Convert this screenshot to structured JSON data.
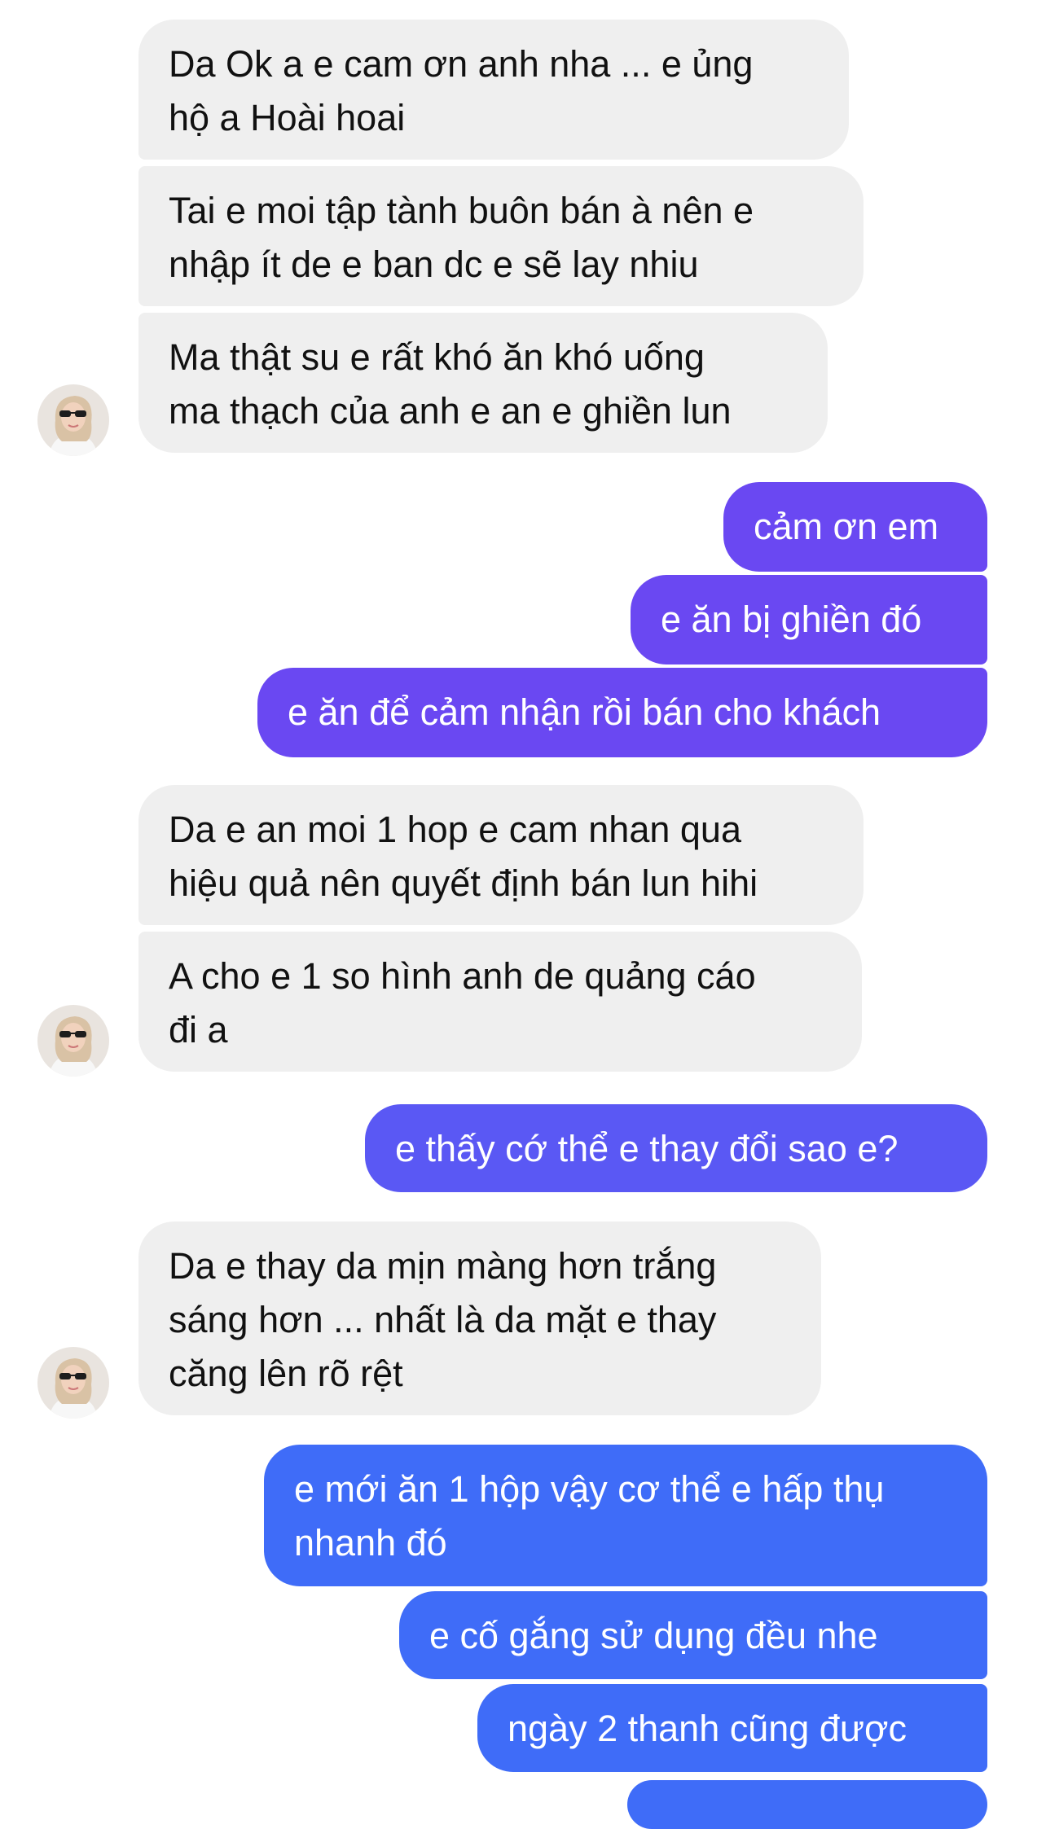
{
  "colors": {
    "incoming_bg": "#efefef",
    "outgoing_purple": "#6a48f2",
    "outgoing_blue": "#3f6cf8",
    "incoming_text": "#111111",
    "outgoing_text": "#ffffff"
  },
  "contact": {
    "avatar_icon": "profile-photo-woman-sunglasses"
  },
  "messages": [
    {
      "side": "incoming",
      "lines": [
        "Da Ok a e cam ơn anh nha ... e ủng",
        "hộ a Hoài hoai"
      ]
    },
    {
      "side": "incoming",
      "lines": [
        "Tai e moi tập tành buôn bán à nên e",
        "nhập ít de e ban dc e sẽ lay nhiu"
      ]
    },
    {
      "side": "incoming",
      "lines": [
        "Ma thật su e rất khó ăn khó uống",
        "ma thạch của anh e an e ghiền lun"
      ]
    },
    {
      "side": "outgoing",
      "lines": [
        "cảm ơn em"
      ]
    },
    {
      "side": "outgoing",
      "lines": [
        "e ăn bị ghiền đó"
      ]
    },
    {
      "side": "outgoing",
      "lines": [
        "e ăn để cảm nhận rồi bán cho khách"
      ]
    },
    {
      "side": "incoming",
      "lines": [
        "Da e an moi 1 hop e cam nhan qua",
        "hiệu quả nên quyết định bán lun hihi"
      ]
    },
    {
      "side": "incoming",
      "lines": [
        "A cho e 1 so hình anh de quảng cáo",
        "đi a"
      ]
    },
    {
      "side": "outgoing",
      "lines": [
        "e thấy cớ thể e thay đổi sao e?"
      ]
    },
    {
      "side": "incoming",
      "lines": [
        "Da e thay da mịn màng hơn trắng",
        "sáng hơn ... nhất là da mặt e thay",
        "căng lên rõ rệt"
      ]
    },
    {
      "side": "outgoing",
      "lines": [
        "e mới ăn 1 hộp vậy cơ thể e hấp thụ",
        "nhanh đó"
      ]
    },
    {
      "side": "outgoing",
      "lines": [
        "e cố gắng sử dụng đều nhe"
      ]
    },
    {
      "side": "outgoing",
      "lines": [
        "ngày 2 thanh cũng được"
      ]
    }
  ]
}
